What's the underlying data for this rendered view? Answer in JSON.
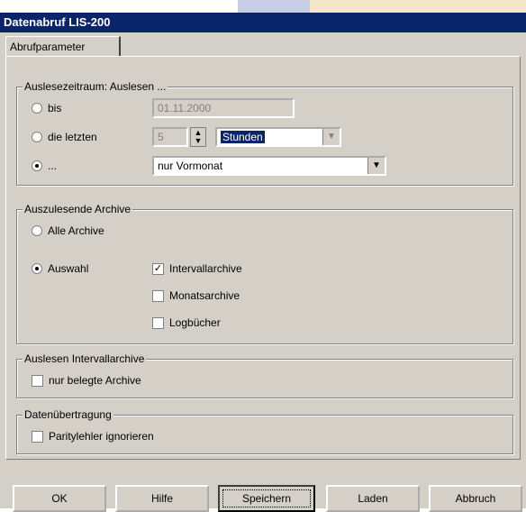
{
  "window": {
    "title": "Datenabruf LIS-200"
  },
  "tabs": [
    {
      "label": "Abrufparameter"
    }
  ],
  "readout_group": {
    "title": "Auslesezeitraum: Auslesen ...",
    "bis_label": "bis",
    "bis_date": "01.11.2000",
    "last_label": "die letzten",
    "last_value": "5",
    "unit_selected": "Stunden",
    "third_label": "...",
    "period_value": "nur Vormonat"
  },
  "archive_group": {
    "title": "Auszulesende Archive",
    "all_label": "Alle Archive",
    "selection_label": "Auswahl",
    "items": [
      {
        "label": "Intervallarchive",
        "checked": true
      },
      {
        "label": "Monatsarchive",
        "checked": false
      },
      {
        "label": "Logbücher",
        "checked": false
      }
    ]
  },
  "interval_group": {
    "title": "Auslesen Intervallarchive",
    "only_used_label": "nur belegte Archive"
  },
  "transfer_group": {
    "title": "Datenübertragung",
    "ignore_parity_label": "Paritylehler ignorieren"
  },
  "buttons": {
    "ok": "OK",
    "help": "Hilfe",
    "save": "Speichern",
    "load": "Laden",
    "cancel": "Abbruch"
  }
}
